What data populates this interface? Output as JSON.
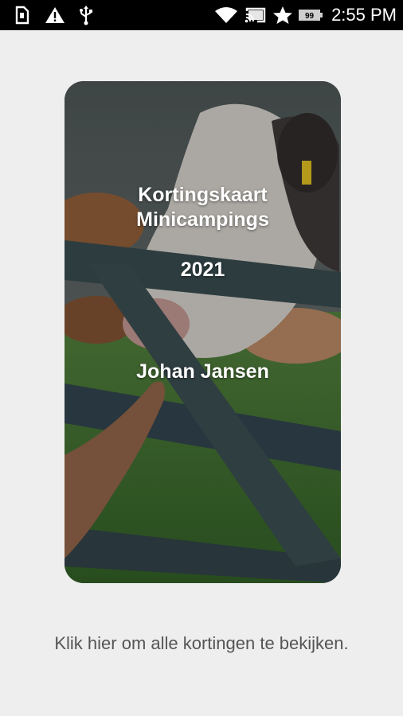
{
  "status_bar": {
    "time": "2:55 PM",
    "battery_level": "99",
    "icons": [
      "sim-card-icon",
      "warning-icon",
      "usb-icon",
      "wifi-icon",
      "cast-icon",
      "star-icon",
      "battery-icon"
    ]
  },
  "card": {
    "title_line1": "Kortingskaart",
    "title_line2": "Minicampings",
    "year": "2021",
    "holder_name": "Johan Jansen"
  },
  "footer": {
    "link_text": "Klik hier om alle kortingen te bekijken."
  },
  "colors": {
    "background": "#eeeeee",
    "status_bar": "#000000",
    "card_text": "#ffffff",
    "footer_text": "#555555"
  }
}
